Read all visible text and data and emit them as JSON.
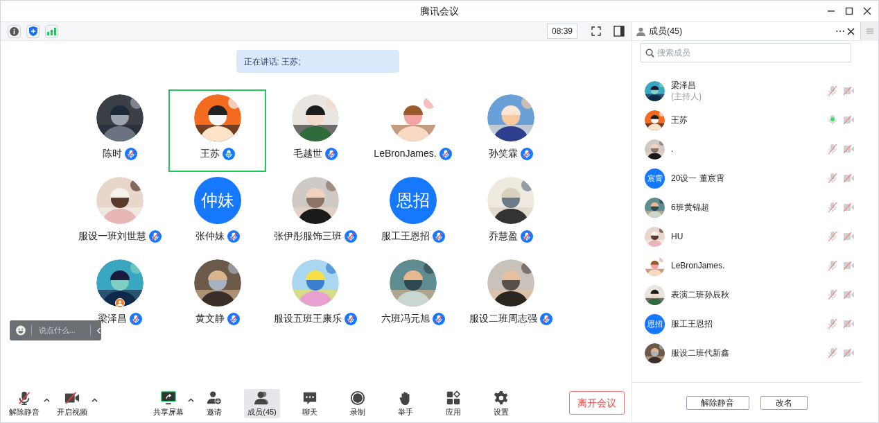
{
  "window": {
    "title": "腾讯会议"
  },
  "top_toolbar": {
    "timer": "08:39"
  },
  "speaking_banner": "正在讲话: 王苏;",
  "participants": [
    {
      "name": "陈时",
      "speaking": false,
      "host": false
    },
    {
      "name": "王苏",
      "speaking": true,
      "host": false
    },
    {
      "name": "毛越世",
      "speaking": false,
      "host": false
    },
    {
      "name": "LeBronJames.",
      "speaking": false,
      "host": false
    },
    {
      "name": "孙笑霖",
      "speaking": false,
      "host": false
    },
    {
      "name": "服设一班刘世慧",
      "speaking": false,
      "host": false
    },
    {
      "name": "张仲妹",
      "avatar": {
        "kind": "text",
        "text": "仲妹"
      },
      "speaking": false,
      "host": false
    },
    {
      "name": "张伊彤服饰三班",
      "speaking": false,
      "host": false
    },
    {
      "name": "服工王恩招",
      "avatar": {
        "kind": "text",
        "text": "恩招"
      },
      "speaking": false,
      "host": false
    },
    {
      "name": "乔慧盈",
      "speaking": false,
      "host": false
    },
    {
      "name": "梁泽昌",
      "speaking": false,
      "host": true
    },
    {
      "name": "黄文静",
      "speaking": false,
      "host": false
    },
    {
      "name": "服设五班王康乐",
      "speaking": false,
      "host": false
    },
    {
      "name": "六班冯元旭",
      "speaking": false,
      "host": false
    },
    {
      "name": "服设二班周志强",
      "speaking": false,
      "host": false
    }
  ],
  "chat_input": {
    "placeholder": "说点什么..."
  },
  "bottom_toolbar": [
    {
      "label": "解除静音",
      "has_menu": true,
      "selected": false
    },
    {
      "label": "开启视频",
      "has_menu": true,
      "selected": false
    },
    {
      "label": "共享屏幕",
      "has_menu": true,
      "selected": false
    },
    {
      "label": "邀请",
      "has_menu": false,
      "selected": false
    },
    {
      "label": "成员(45)",
      "has_menu": false,
      "selected": true
    },
    {
      "label": "聊天",
      "has_menu": false,
      "selected": false
    },
    {
      "label": "录制",
      "has_menu": false,
      "selected": false
    },
    {
      "label": "举手",
      "has_menu": false,
      "selected": false
    },
    {
      "label": "应用",
      "has_menu": false,
      "selected": false
    },
    {
      "label": "设置",
      "has_menu": false,
      "selected": false
    }
  ],
  "leave_button": "离开会议",
  "members_panel": {
    "title": "成员(45)",
    "more": "⋯",
    "search": {
      "placeholder": "搜索成员"
    },
    "members": [
      {
        "name": "梁泽昌",
        "role": "(主持人)",
        "mic_on": false,
        "video_on": false
      },
      {
        "name": "王苏",
        "mic_on": true,
        "video_on": false
      },
      {
        "name": ".",
        "mic_on": false,
        "video_on": false
      },
      {
        "name": "20设一 董宸霄",
        "avatar": {
          "kind": "text",
          "text": "宸霄"
        },
        "mic_on": false,
        "video_on": false
      },
      {
        "name": "6班黄锦超",
        "mic_on": false,
        "video_on": false
      },
      {
        "name": "HU",
        "mic_on": false,
        "video_on": false
      },
      {
        "name": "LeBronJames.",
        "mic_on": false,
        "video_on": false
      },
      {
        "name": "表演二班孙辰秋",
        "mic_on": false,
        "video_on": false
      },
      {
        "name": "服工王恩招",
        "avatar": {
          "kind": "text",
          "text": "恩招"
        },
        "mic_on": false,
        "video_on": false
      },
      {
        "name": "服设二班代新鑫",
        "mic_on": false,
        "video_on": false
      }
    ],
    "buttons": [
      "解除静音",
      "改名"
    ]
  }
}
